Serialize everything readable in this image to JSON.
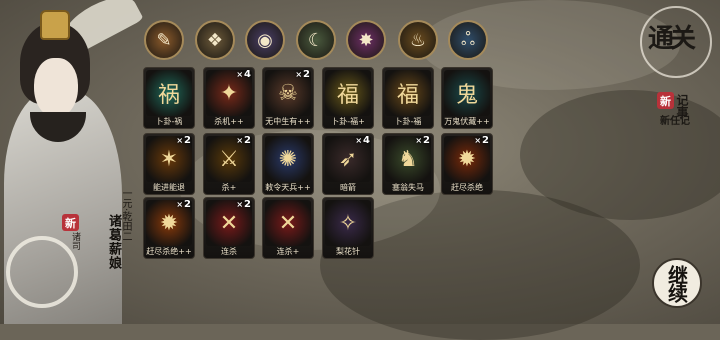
{
  "character": {
    "title": "一元·乾田二",
    "name": "诸葛薪娘",
    "nickname": "诸葛",
    "stamp": "新",
    "stamp_sub": "诸司"
  },
  "skills": [
    {
      "icon": "feather-scroll-icon",
      "glyph": "✎",
      "color": "#8b5a2b"
    },
    {
      "icon": "lotus-shield-icon",
      "glyph": "❖",
      "color": "#6d5a3a"
    },
    {
      "icon": "eye-vortex-icon",
      "glyph": "◉",
      "color": "#4a3f66"
    },
    {
      "icon": "moon-slash-icon",
      "glyph": "☾",
      "color": "#4a5a3e"
    },
    {
      "icon": "violet-spark-icon",
      "glyph": "✸",
      "color": "#6e2f66"
    },
    {
      "icon": "golden-bowl-icon",
      "glyph": "♨",
      "color": "#6a4b1e"
    },
    {
      "icon": "triskele-icon",
      "glyph": "ஃ",
      "color": "#2f4d6a"
    }
  ],
  "cards": [
    {
      "label": "卜卦-祸",
      "count": "",
      "color": "#1f6a5a",
      "glyph": "祸"
    },
    {
      "label": "杀机++",
      "count": "4",
      "color": "#7a2a1a",
      "glyph": "✦"
    },
    {
      "label": "无中生有++",
      "count": "2",
      "color": "#5a3a2a",
      "glyph": "☠"
    },
    {
      "label": "卜卦-福+",
      "count": "",
      "color": "#6a5a1a",
      "glyph": "福"
    },
    {
      "label": "卜卦-福",
      "count": "",
      "color": "#6a4a1a",
      "glyph": "福"
    },
    {
      "label": "万鬼伏藏++",
      "count": "",
      "color": "#1a4a4a",
      "glyph": "鬼"
    },
    {
      "label": "能进能退",
      "count": "2",
      "color": "#6a3a0a",
      "glyph": "✶"
    },
    {
      "label": "杀+",
      "count": "2",
      "color": "#5a3a0a",
      "glyph": "⚔"
    },
    {
      "label": "敕令天兵++",
      "count": "",
      "color": "#2a3a6a",
      "glyph": "✺"
    },
    {
      "label": "暗箭",
      "count": "4",
      "color": "#3a2a2a",
      "glyph": "➶"
    },
    {
      "label": "塞翁失马",
      "count": "2",
      "color": "#3a4a2a",
      "glyph": "♞"
    },
    {
      "label": "赶尽杀绝",
      "count": "2",
      "color": "#7a2a0a",
      "glyph": "✹"
    },
    {
      "label": "赶尽杀绝++",
      "count": "2",
      "color": "#8a3a0a",
      "glyph": "✹"
    },
    {
      "label": "连杀",
      "count": "2",
      "color": "#7a1a1a",
      "glyph": "✕"
    },
    {
      "label": "连杀+",
      "count": "",
      "color": "#7a1a1a",
      "glyph": "✕"
    },
    {
      "label": "梨花针",
      "count": "",
      "color": "#3a2a4a",
      "glyph": "✧"
    }
  ],
  "seals": {
    "top": "通关",
    "new_record": "新任记",
    "new_record_sub": "记事",
    "continue": "继续"
  }
}
